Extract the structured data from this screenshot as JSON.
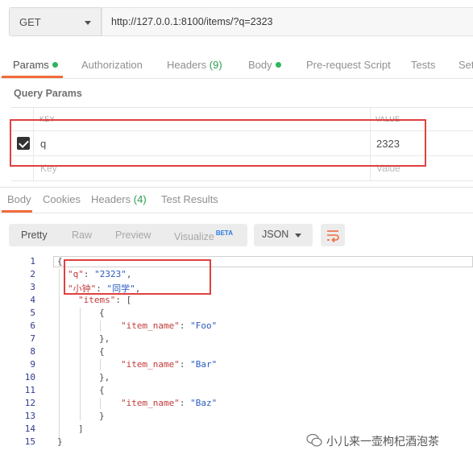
{
  "request": {
    "method": "GET",
    "url": "http://127.0.0.1:8100/items/?q=2323"
  },
  "request_tabs": [
    {
      "label": "Params",
      "dot": true
    },
    {
      "label": "Authorization"
    },
    {
      "label": "Headers",
      "count": "(9)"
    },
    {
      "label": "Body",
      "dot": true
    },
    {
      "label": "Pre-request Script"
    },
    {
      "label": "Tests"
    },
    {
      "label": "Set"
    }
  ],
  "query_params": {
    "title": "Query Params",
    "key_header": "KEY",
    "value_header": "VALUE",
    "rows": [
      {
        "key": "q",
        "value": "2323",
        "checked": true
      }
    ],
    "key_placeholder": "Key",
    "value_placeholder": "Value"
  },
  "response_tabs": [
    {
      "label": "Body"
    },
    {
      "label": "Cookies"
    },
    {
      "label": "Headers",
      "count": "(4)"
    },
    {
      "label": "Test Results"
    }
  ],
  "view_modes": [
    "Pretty",
    "Raw",
    "Preview",
    "Visualize"
  ],
  "beta_badge": "BETA",
  "format": "JSON",
  "code_lines": [
    {
      "n": "1",
      "tokens": [
        {
          "t": "{",
          "c": "p"
        }
      ]
    },
    {
      "n": "2",
      "tokens": [
        {
          "t": "\"q\"",
          "c": "k"
        },
        {
          "t": ": ",
          "c": "p"
        },
        {
          "t": "\"2323\"",
          "c": "s"
        },
        {
          "t": ",",
          "c": "p"
        }
      ]
    },
    {
      "n": "3",
      "tokens": [
        {
          "t": "\"小钟\"",
          "c": "k"
        },
        {
          "t": ": ",
          "c": "p"
        },
        {
          "t": "\"同学\"",
          "c": "s"
        },
        {
          "t": ",",
          "c": "p"
        }
      ]
    },
    {
      "n": "4",
      "tokens": [
        {
          "t": "\"items\"",
          "c": "k"
        },
        {
          "t": ": [",
          "c": "p"
        }
      ]
    },
    {
      "n": "5",
      "tokens": [
        {
          "t": "{",
          "c": "p"
        }
      ]
    },
    {
      "n": "6",
      "tokens": [
        {
          "t": "\"item_name\"",
          "c": "k"
        },
        {
          "t": ": ",
          "c": "p"
        },
        {
          "t": "\"Foo\"",
          "c": "s"
        }
      ]
    },
    {
      "n": "7",
      "tokens": [
        {
          "t": "},",
          "c": "p"
        }
      ]
    },
    {
      "n": "8",
      "tokens": [
        {
          "t": "{",
          "c": "p"
        }
      ]
    },
    {
      "n": "9",
      "tokens": [
        {
          "t": "\"item_name\"",
          "c": "k"
        },
        {
          "t": ": ",
          "c": "p"
        },
        {
          "t": "\"Bar\"",
          "c": "s"
        }
      ]
    },
    {
      "n": "10",
      "tokens": [
        {
          "t": "},",
          "c": "p"
        }
      ]
    },
    {
      "n": "11",
      "tokens": [
        {
          "t": "{",
          "c": "p"
        }
      ]
    },
    {
      "n": "12",
      "tokens": [
        {
          "t": "\"item_name\"",
          "c": "k"
        },
        {
          "t": ": ",
          "c": "p"
        },
        {
          "t": "\"Baz\"",
          "c": "s"
        }
      ]
    },
    {
      "n": "13",
      "tokens": [
        {
          "t": "}",
          "c": "p"
        }
      ]
    },
    {
      "n": "14",
      "tokens": [
        {
          "t": "]",
          "c": "p"
        }
      ]
    },
    {
      "n": "15",
      "tokens": [
        {
          "t": "}",
          "c": "p"
        }
      ]
    }
  ],
  "watermark": "小儿来一壶枸杞酒泡茶",
  "colors": {
    "accent": "#f26b3a",
    "active_dot": "#2fb55c",
    "json_key": "#c23a3a",
    "json_string": "#2a5bbf",
    "annotation_box": "#e04040"
  }
}
